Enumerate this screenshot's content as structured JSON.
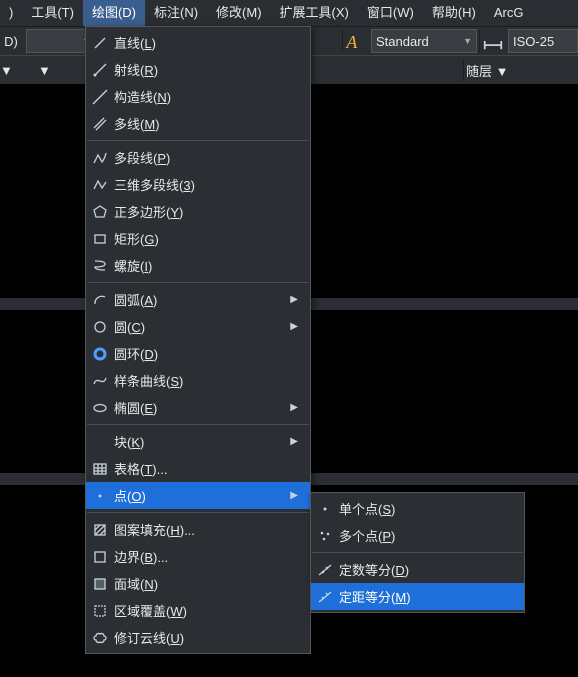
{
  "menubar": [
    {
      "label": ")"
    },
    {
      "label": "工具(T)"
    },
    {
      "label": "绘图(D)",
      "active": true
    },
    {
      "label": "标注(N)"
    },
    {
      "label": "修改(M)"
    },
    {
      "label": "扩展工具(X)"
    },
    {
      "label": "窗口(W)"
    },
    {
      "label": "帮助(H)"
    },
    {
      "label": "ArcG"
    }
  ],
  "toolbar": {
    "dropdown1": "",
    "textstyle": "Standard",
    "dimstyle": "ISO-25"
  },
  "ribbon2": {
    "bylayer": "随层"
  },
  "draw_menu": [
    {
      "icon": "line",
      "label": "直线(L)"
    },
    {
      "icon": "ray",
      "label": "射线(R)"
    },
    {
      "icon": "xline",
      "label": "构造线(N)"
    },
    {
      "icon": "mline",
      "label": "多线(M)"
    },
    {
      "sep": true
    },
    {
      "icon": "pline",
      "label": "多段线(P)"
    },
    {
      "icon": "3dpoly",
      "label": "三维多段线(3)"
    },
    {
      "icon": "polygon",
      "label": "正多边形(Y)"
    },
    {
      "icon": "rect",
      "label": "矩形(G)"
    },
    {
      "icon": "helix",
      "label": "螺旋(I)"
    },
    {
      "sep": true
    },
    {
      "icon": "arc",
      "label": "圆弧(A)",
      "sub": true
    },
    {
      "icon": "circle",
      "label": "圆(C)",
      "sub": true
    },
    {
      "icon": "donut",
      "label": "圆环(D)"
    },
    {
      "icon": "spline",
      "label": "样条曲线(S)"
    },
    {
      "icon": "ellipse",
      "label": "椭圆(E)",
      "sub": true
    },
    {
      "sep": true
    },
    {
      "icon": "block",
      "label": "块(K)",
      "sub": true
    },
    {
      "icon": "table",
      "label": "表格(T)..."
    },
    {
      "icon": "point",
      "label": "点(O)",
      "sub": true,
      "highlight": true
    },
    {
      "sep": true
    },
    {
      "icon": "hatch",
      "label": "图案填充(H)..."
    },
    {
      "icon": "boundary",
      "label": "边界(B)..."
    },
    {
      "icon": "region",
      "label": "面域(N)"
    },
    {
      "icon": "wipeout",
      "label": "区域覆盖(W)"
    },
    {
      "icon": "revcloud",
      "label": "修订云线(U)"
    }
  ],
  "point_submenu": [
    {
      "icon": "singlepoint",
      "label": "单个点(S)"
    },
    {
      "icon": "multipoint",
      "label": "多个点(P)"
    },
    {
      "sep": true
    },
    {
      "icon": "divide",
      "label": "定数等分(D)"
    },
    {
      "icon": "measure",
      "label": "定距等分(M)",
      "highlight": true
    }
  ]
}
